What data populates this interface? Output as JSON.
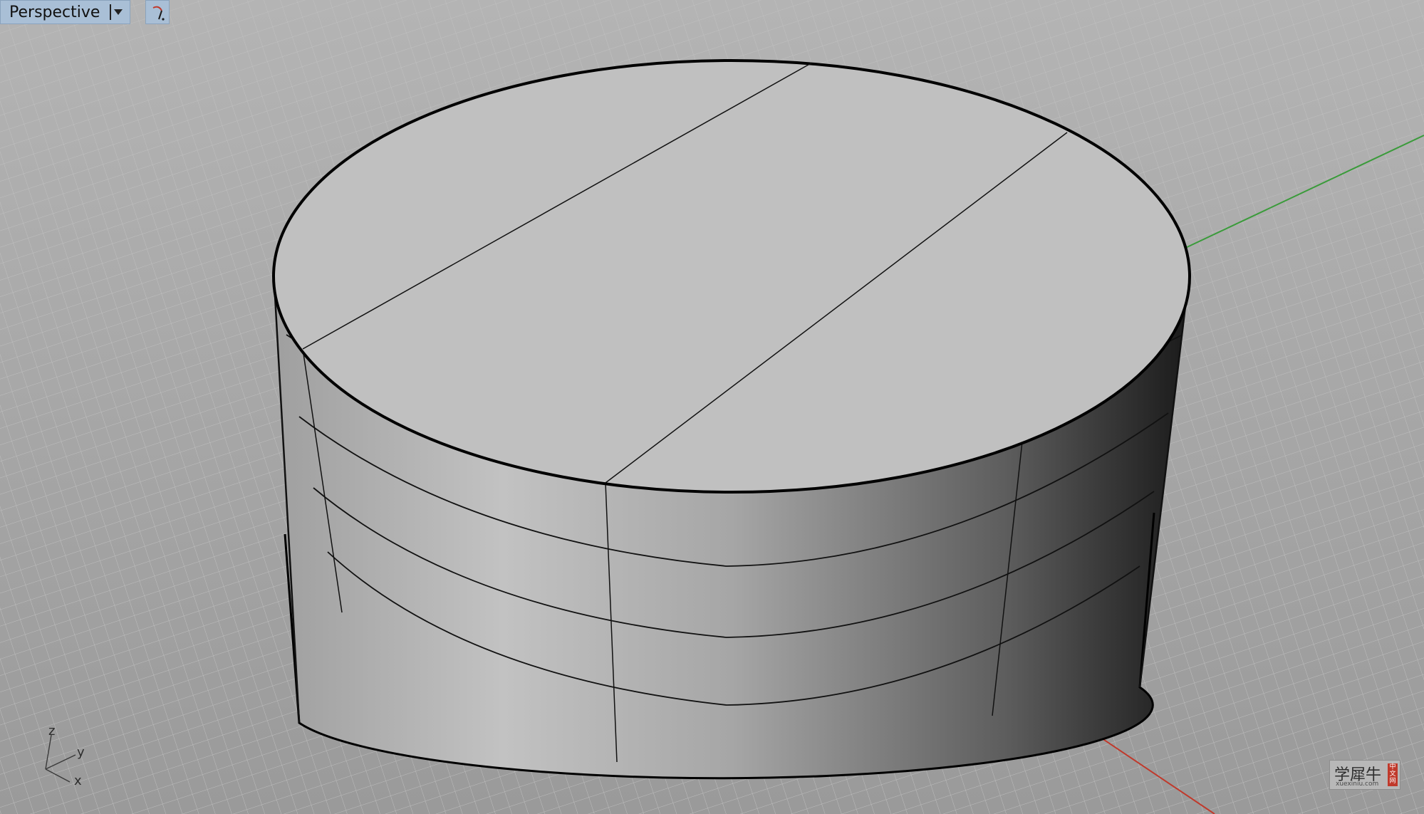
{
  "viewport": {
    "name": "Perspective"
  },
  "axis_labels": {
    "z": "z",
    "y": "y",
    "x": "x"
  },
  "logo": {
    "main_text": "学犀牛",
    "sub_text": "xuexiniu.com",
    "seal_text": "中文网"
  },
  "colors": {
    "background": "#a9a9a9",
    "grid_line": "#c3c3c3",
    "x_axis": "#c0392b",
    "y_axis": "#3a9b3a",
    "title_bar": "#a9bfd6"
  },
  "icons": {
    "viewport_menu": "dropdown-arrow-icon",
    "viewport_tool": "rotate-view-icon"
  }
}
